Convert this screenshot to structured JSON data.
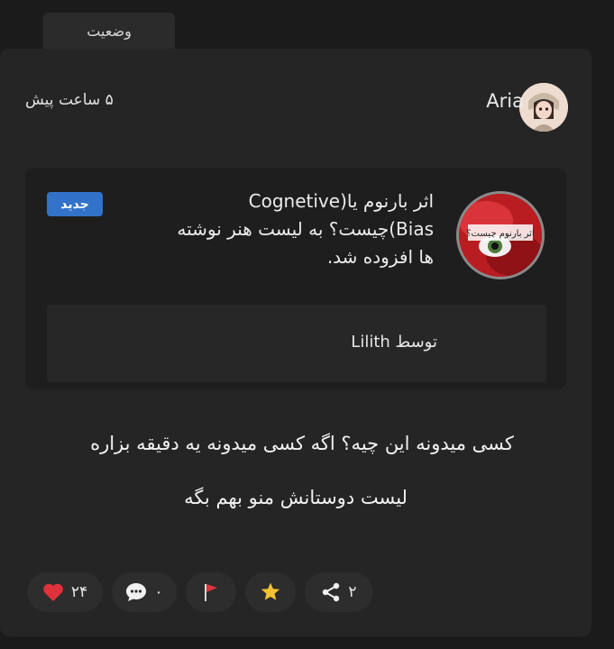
{
  "tab": {
    "label": "وضعیت"
  },
  "post": {
    "author": "Aria",
    "time": "۵ ساعت پیش",
    "body_line1": "کسی میدونه این چیه؟ اگه کسی میدونه یه دقیقه بزاره",
    "body_line2": "لیست دوستانش منو بهم بگه"
  },
  "notification": {
    "text": "اثر بارنوم یا(Cognetive Bias)چیست؟ به لیست هنر نوشته ها افزوده شد.",
    "badge": "جدید",
    "byline": "توسط Lilith",
    "thumb_caption": "اثر بارنوم چیست؟"
  },
  "actions": {
    "likes": {
      "count": "۲۴",
      "icon": "heart-icon",
      "color": "#e0323b"
    },
    "comments": {
      "count": "۰",
      "icon": "comment-icon"
    },
    "report": {
      "icon": "flag-icon",
      "color": "#e0323b"
    },
    "favorite": {
      "icon": "star-icon",
      "color": "#f2c230"
    },
    "share": {
      "count": "۲",
      "icon": "share-icon"
    }
  },
  "colors": {
    "background": "#1b1b1b",
    "card": "#252525",
    "badge": "#3273c9"
  }
}
